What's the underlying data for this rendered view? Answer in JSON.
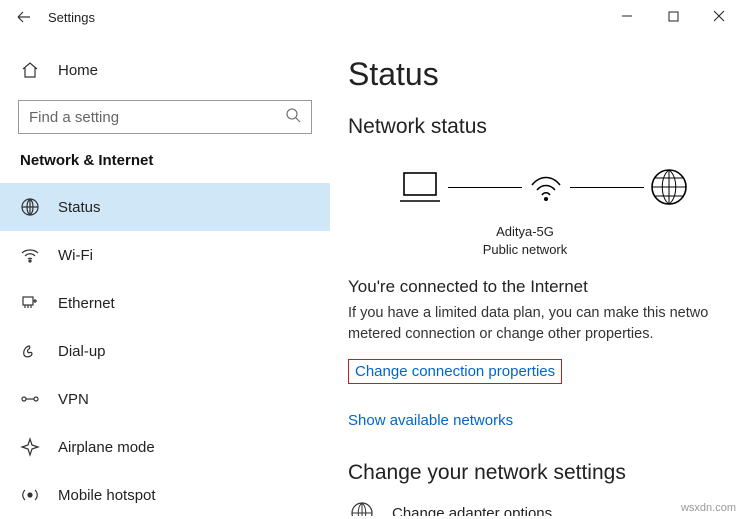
{
  "titlebar": {
    "app_title": "Settings"
  },
  "sidebar": {
    "home_label": "Home",
    "search_placeholder": "Find a setting",
    "section_header": "Network & Internet",
    "items": [
      {
        "label": "Status"
      },
      {
        "label": "Wi-Fi"
      },
      {
        "label": "Ethernet"
      },
      {
        "label": "Dial-up"
      },
      {
        "label": "VPN"
      },
      {
        "label": "Airplane mode"
      },
      {
        "label": "Mobile hotspot"
      }
    ]
  },
  "content": {
    "page_title": "Status",
    "network_status_heading": "Network status",
    "connection_name": "Aditya-5G",
    "connection_type": "Public network",
    "connected_heading": "You're connected to the Internet",
    "connected_desc": "If you have a limited data plan, you can make this netwo metered connection or change other properties.",
    "change_props_link": "Change connection properties",
    "show_networks_link": "Show available networks",
    "change_settings_heading": "Change your network settings",
    "adapter_options_label": "Change adapter options"
  },
  "watermark": "wsxdn.com"
}
